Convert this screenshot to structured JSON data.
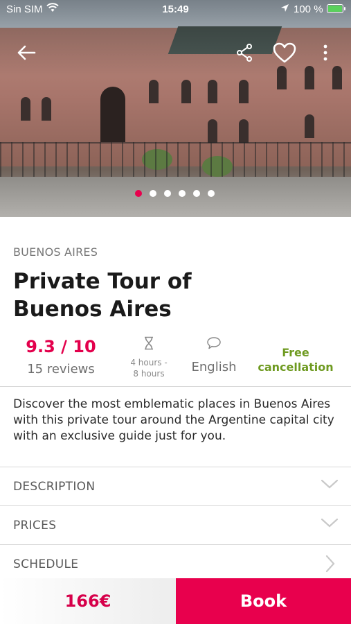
{
  "status_bar": {
    "carrier": "Sin SIM",
    "time": "15:49",
    "battery": "100 %"
  },
  "header": {
    "back_icon": "arrow-left-icon",
    "share_icon": "share-icon",
    "favorite_icon": "heart-outline-icon",
    "more_icon": "more-vertical-icon"
  },
  "gallery": {
    "photo_count": 6,
    "active_index": 0
  },
  "tour": {
    "city": "BUENOS AIRES",
    "title": "Private Tour of Buenos Aires",
    "rating": "9.3 / 10",
    "reviews": "15 reviews",
    "duration_line1": "4 hours -",
    "duration_line2": "8 hours",
    "language": "English",
    "cancellation_line1": "Free",
    "cancellation_line2": "cancellation",
    "description": "Discover the most emblematic places in Buenos Aires with this private tour around the Argentine capital city with an exclusive guide just for you."
  },
  "sections": [
    {
      "label": "DESCRIPTION",
      "icon": "chevron-down-icon"
    },
    {
      "label": "PRICES",
      "icon": "chevron-down-icon"
    },
    {
      "label": "SCHEDULE",
      "icon": "chevron-right-icon"
    }
  ],
  "booking": {
    "price": "166€",
    "button_label": "Book"
  },
  "colors": {
    "accent": "#e8004d",
    "rating": "#e3004c",
    "cancellation": "#6e9a20"
  }
}
